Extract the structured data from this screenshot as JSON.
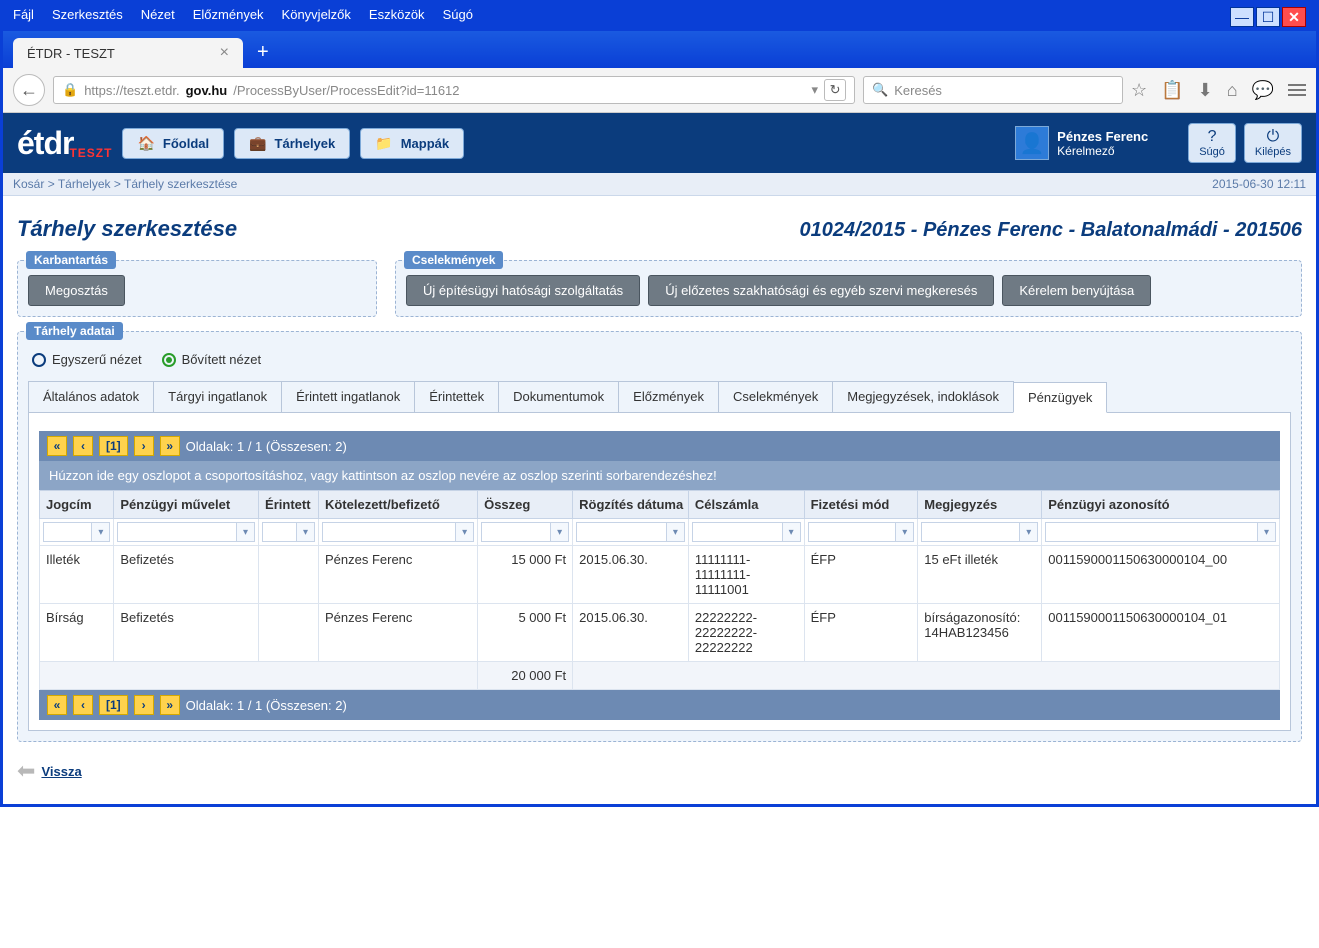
{
  "browser": {
    "menu": [
      "Fájl",
      "Szerkesztés",
      "Nézet",
      "Előzmények",
      "Könyvjelzők",
      "Eszközök",
      "Súgó"
    ],
    "tab_title": "ÉTDR - TESZT",
    "url_host": "https://teszt.etdr.",
    "url_domain": "gov.hu",
    "url_path": "/ProcessByUser/ProcessEdit?id=11612",
    "search_placeholder": "Keresés"
  },
  "header": {
    "logo": "étdr",
    "logo_tag": "TESZT",
    "nav": [
      {
        "label": "Főoldal",
        "icon": "🏠"
      },
      {
        "label": "Tárhelyek",
        "icon": "💼"
      },
      {
        "label": "Mappák",
        "icon": "📁"
      }
    ],
    "user_name": "Pénzes Ferenc",
    "user_role": "Kérelmező",
    "help": {
      "label": "Súgó",
      "icon": "?"
    },
    "logout": {
      "label": "Kilépés",
      "icon": "⏻"
    }
  },
  "breadcrumb": {
    "items": [
      "Kosár",
      "Tárhelyek",
      "Tárhely szerkesztése"
    ],
    "timestamp": "2015-06-30 12:11"
  },
  "page": {
    "title": "Tárhely szerkesztése",
    "subtitle": "01024/2015 - Pénzes Ferenc - Balatonalmádi - 201506"
  },
  "panels": {
    "karbantartas": {
      "legend": "Karbantartás",
      "buttons": [
        "Megosztás"
      ]
    },
    "cselekmenyek": {
      "legend": "Cselekmények",
      "buttons": [
        "Új építésügyi hatósági szolgáltatás",
        "Új előzetes szakhatósági és egyéb szervi megkeresés",
        "Kérelem benyújtása"
      ]
    },
    "adatai": {
      "legend": "Tárhely adatai",
      "view_simple": "Egyszerű nézet",
      "view_extended": "Bővített nézet",
      "tabs": [
        "Általános adatok",
        "Tárgyi ingatlanok",
        "Érintett ingatlanok",
        "Érintettek",
        "Dokumentumok",
        "Előzmények",
        "Cselekmények",
        "Megjegyzések, indoklások",
        "Pénzügyek"
      ],
      "active_tab": 8
    }
  },
  "pager": {
    "current": "[1]",
    "text": "Oldalak: 1 / 1 (Összesen: 2)"
  },
  "grid": {
    "group_hint": "Húzzon ide egy oszlopot a csoportosításhoz, vagy kattintson az oszlop nevére az oszlop szerinti sorbarendezéshez!",
    "columns": [
      "Jogcím",
      "Pénzügyi művelet",
      "Érintett",
      "Kötelezett/befizető",
      "Összeg",
      "Rögzítés dátuma",
      "Célszámla",
      "Fizetési mód",
      "Megjegyzés",
      "Pénzügyi azonosító"
    ],
    "rows": [
      {
        "jogc": "Illeték",
        "muv": "Befizetés",
        "erint": "",
        "kot": "Pénzes Ferenc",
        "osszeg": "15 000 Ft",
        "datum": "2015.06.30.",
        "celsz": "11111111-11111111-11111001",
        "fizm": "ÉFP",
        "megj": "15 eFt illeték",
        "azon": "0011590001150630000104_00"
      },
      {
        "jogc": "Bírság",
        "muv": "Befizetés",
        "erint": "",
        "kot": "Pénzes Ferenc",
        "osszeg": "5 000 Ft",
        "datum": "2015.06.30.",
        "celsz": "22222222-22222222-22222222",
        "fizm": "ÉFP",
        "megj": "bírságazonosító: 14HAB123456",
        "azon": "0011590001150630000104_01"
      }
    ],
    "sum": "20 000 Ft"
  },
  "back_label": "Vissza"
}
